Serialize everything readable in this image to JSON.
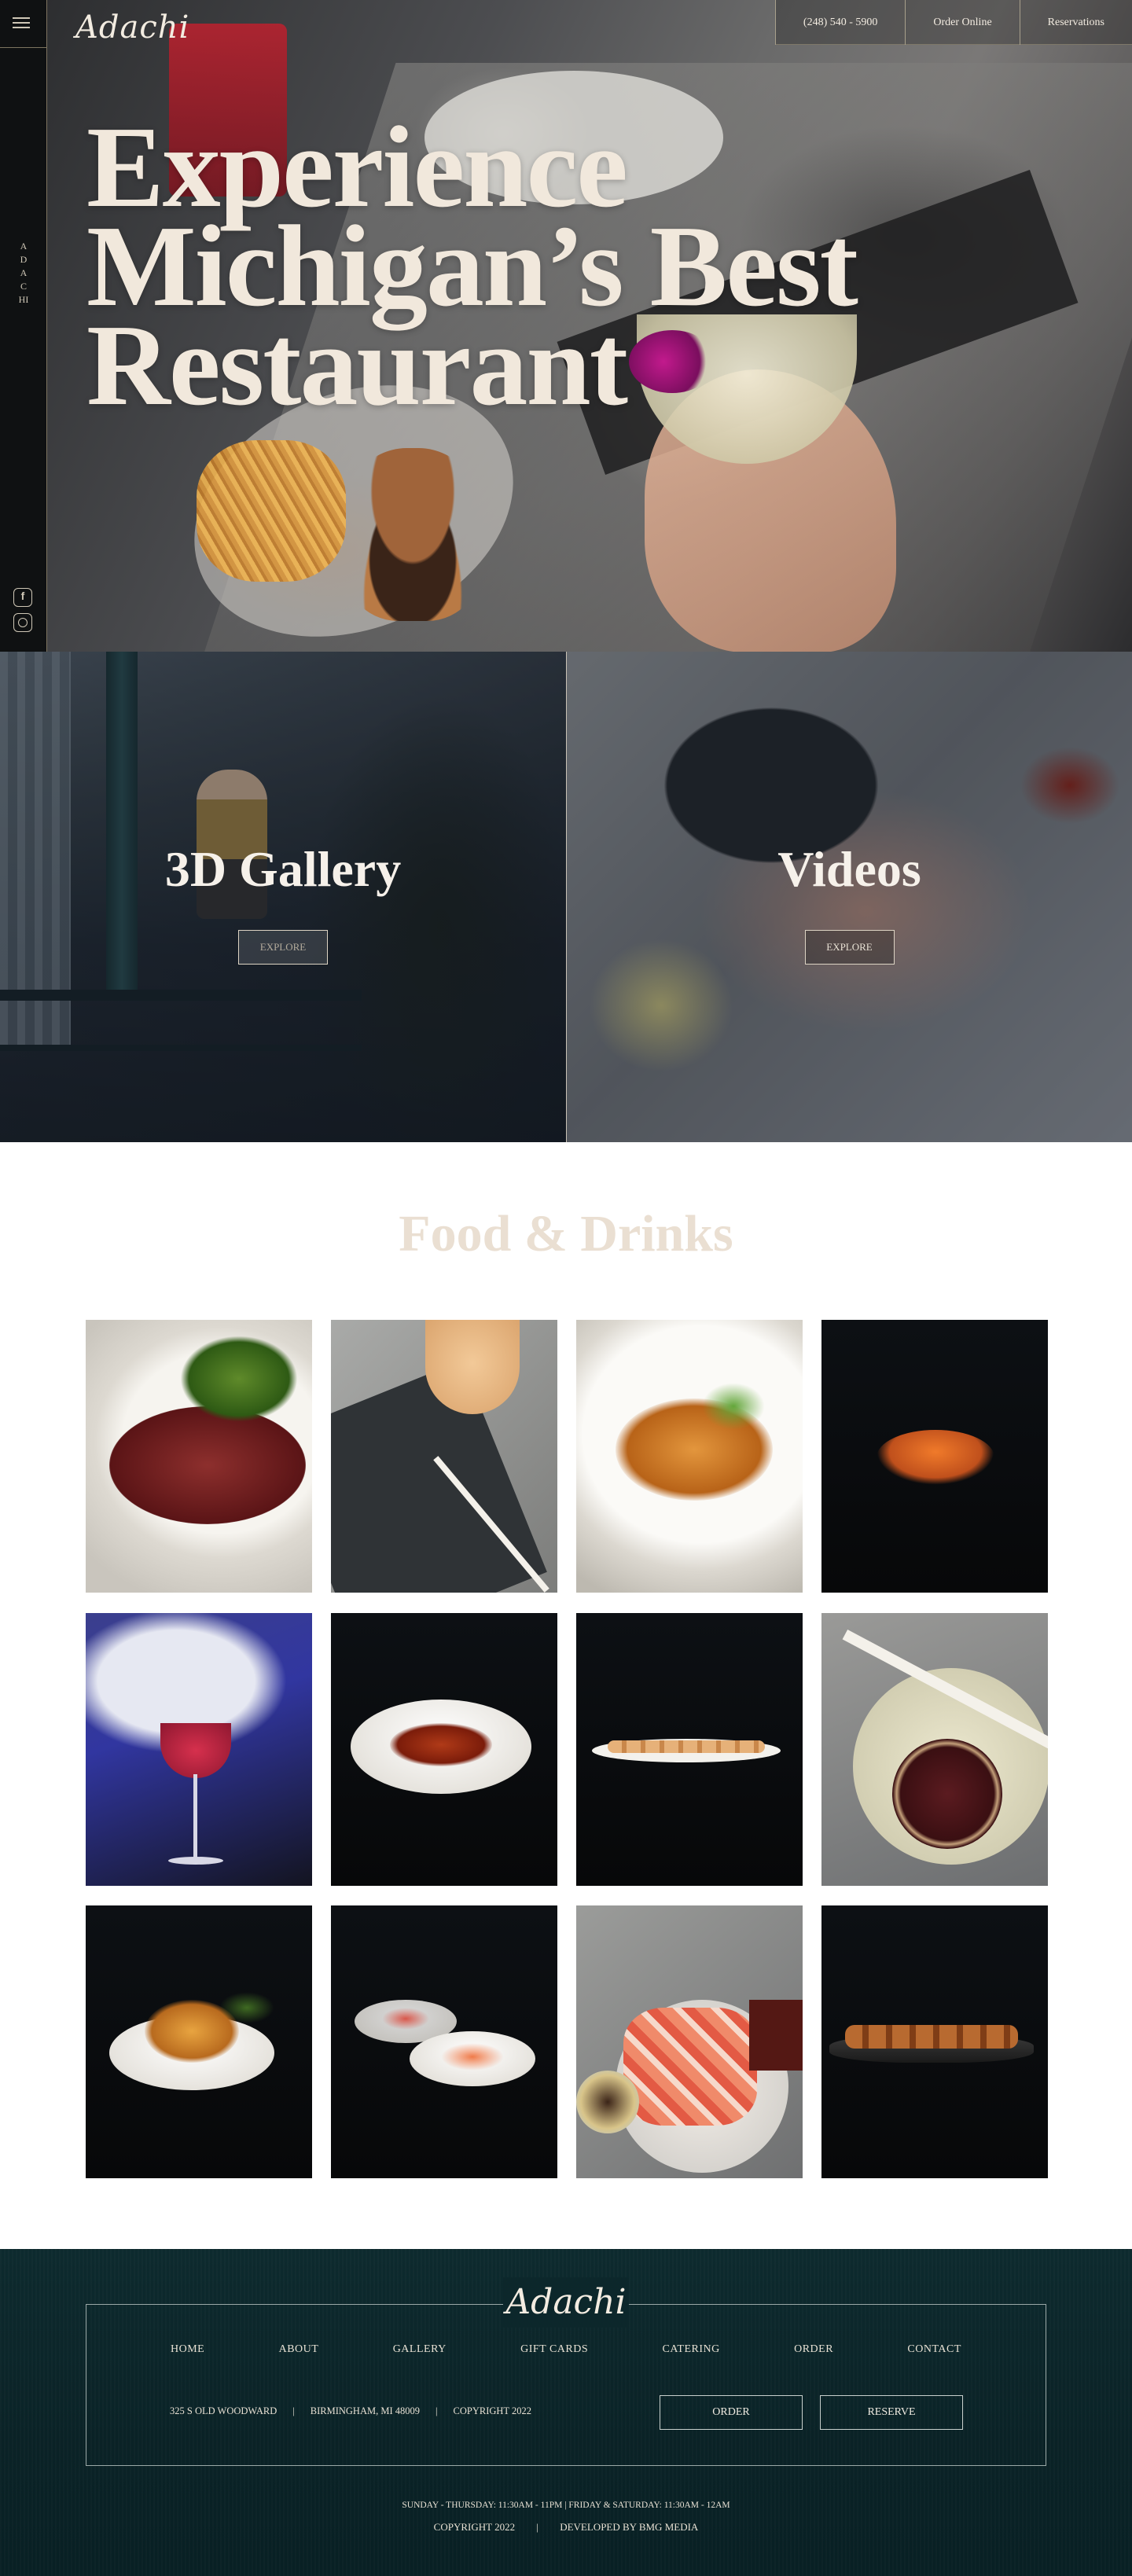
{
  "brand": {
    "logo": "Adachi",
    "vertical": "ADACHI"
  },
  "header": {
    "phone": "(248) 540 - 5900",
    "order": "Order Online",
    "reservations": "Reservations"
  },
  "hero": {
    "line1": "Experience",
    "line2": "Michigan’s Best",
    "line3": "Restaurant"
  },
  "features": [
    {
      "title": "3D Gallery",
      "button": "EXPLORE"
    },
    {
      "title": "Videos",
      "button": "EXPLORE"
    }
  ],
  "food": {
    "title": "Food & Drinks"
  },
  "footer": {
    "logo": "Adachi",
    "nav": [
      "HOME",
      "ABOUT",
      "GALLERY",
      "GIFT CARDS",
      "CATERING",
      "ORDER",
      "CONTACT"
    ],
    "address": "325 S OLD WOODWARD",
    "city": "BIRMINGHAM, MI 48009",
    "copyright": "COPYRIGHT 2022",
    "sep": "|",
    "order_btn": "ORDER",
    "reserve_btn": "RESERVE",
    "hours": "SUNDAY - THURSDAY: 11:30AM - 11PM | FRIDAY & SATURDAY: 11:30AM - 12AM",
    "copy_line": "COPYRIGHT 2022",
    "developer": "DEVELOPED BY BMG MEDIA"
  },
  "icons": [
    "menu-icon",
    "facebook-icon",
    "instagram-icon"
  ]
}
